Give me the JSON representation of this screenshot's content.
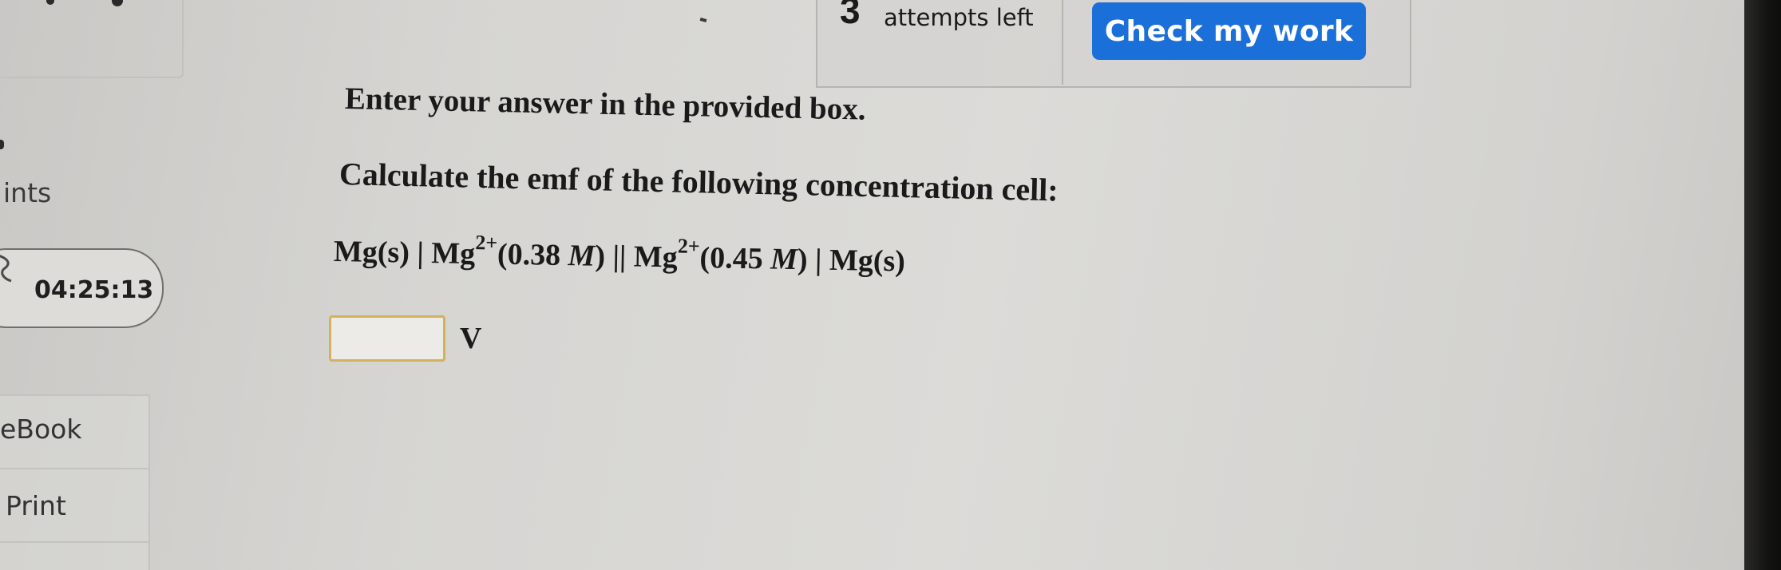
{
  "header": {
    "attempts_count": "3",
    "attempts_label": "attempts left",
    "check_button_label": "Check my work"
  },
  "sidebar": {
    "points_label": "ints",
    "timer": "04:25:13",
    "tabs": [
      {
        "label": "eBook"
      },
      {
        "label": "Print"
      }
    ]
  },
  "question": {
    "instruction": "Enter your answer in the provided box.",
    "prompt": "Calculate the emf of the following concentration cell:",
    "equation": {
      "left_electrode": "Mg(s) | Mg",
      "ion_charge_1": "2+",
      "left_conc_open": "(0.38 ",
      "unit_M_1": "M",
      "salt_bridge_and_right": ") || Mg",
      "ion_charge_2": "2+",
      "right_conc_open": "(0.45 ",
      "unit_M_2": "M",
      "right_electrode": ") | Mg(s)"
    },
    "answer": {
      "value": "",
      "unit": "V"
    }
  },
  "colors": {
    "button_blue": "#1b6fd8",
    "answer_border": "#d3b25e",
    "background": "#d6d5d2"
  }
}
